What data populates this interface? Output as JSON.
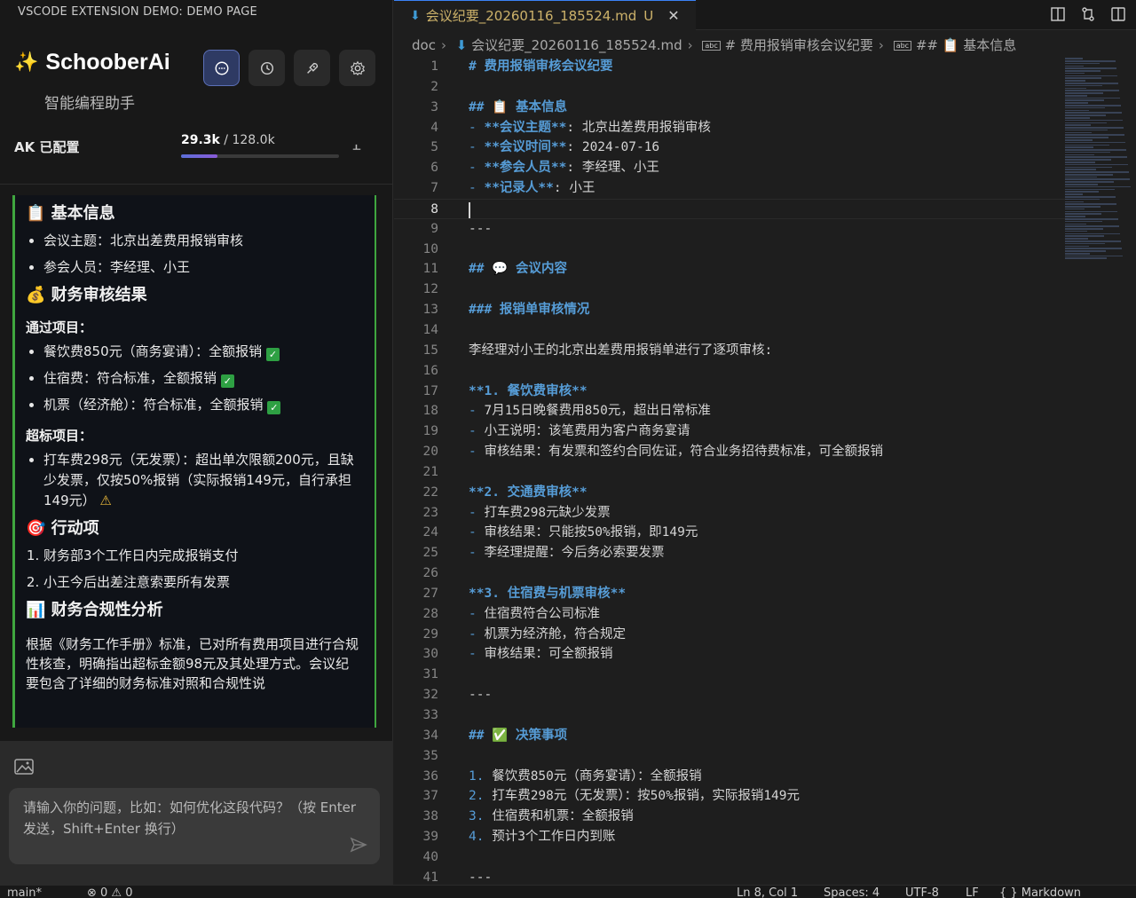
{
  "panel_title": "VSCODE EXTENSION DEMO: DEMO PAGE",
  "brand": {
    "icon": "sparkle-icon",
    "name": "SchooberAi",
    "subtitle": "智能编程助手"
  },
  "header_buttons": [
    "chat-icon",
    "history-icon",
    "rocket-icon",
    "gear-icon"
  ],
  "ak_status": "AK 已配置",
  "tokens": {
    "used": "29.3k",
    "separator": " / ",
    "total": "128.0k",
    "fraction": 0.229
  },
  "message": {
    "h_basic": "📋 基本信息",
    "basic_items": [
      "会议主题：北京出差费用报销审核",
      "参会人员：李经理、小王"
    ],
    "h_result": "💰 财务审核结果",
    "passed_label": "通过项目：",
    "passed_items": [
      "餐饮费850元（商务宴请）：全额报销",
      "住宿费：符合标准，全额报销",
      "机票（经济舱）：符合标准，全额报销"
    ],
    "over_label": "超标项目：",
    "over_items": [
      "打车费298元（无发票）：超出单次限额200元，且缺少发票，仅按50%报销（实际报销149元，自行承担149元）"
    ],
    "h_action": "🎯 行动项",
    "action_items": [
      "财务部3个工作日内完成报销支付",
      "小王今后出差注意索要所有发票"
    ],
    "h_compliance": "📊 财务合规性分析",
    "compliance_text": "根据《财务工作手册》标准，已对所有费用项目进行合规性核查，明确指出超标金额98元及其处理方式。会议纪要包含了详细的财务标准对照和合规性说"
  },
  "input": {
    "placeholder": "请输入你的问题，比如：如何优化这段代码？（按 Enter 发送，Shift+Enter 换行）"
  },
  "editor": {
    "tab": {
      "name": "会议纪要_20260116_185524.md",
      "modified": "U",
      "close": "✕"
    },
    "breadcrumbs": [
      "doc",
      "会议纪要_20260116_185524.md",
      "# 费用报销审核会议纪要",
      "## 📋 基本信息"
    ],
    "current_line": 8,
    "lines": [
      {
        "n": "1",
        "t": "# 费用报销审核会议纪要"
      },
      {
        "n": "2",
        "t": ""
      },
      {
        "n": "3",
        "t": "## 📋 基本信息"
      },
      {
        "n": "4",
        "t": "- **会议主题**: 北京出差费用报销审核"
      },
      {
        "n": "5",
        "t": "- **会议时间**: 2024-07-16"
      },
      {
        "n": "6",
        "t": "- **参会人员**: 李经理、小王"
      },
      {
        "n": "7",
        "t": "- **记录人**: 小王"
      },
      {
        "n": "8",
        "t": ""
      },
      {
        "n": "9",
        "t": "---"
      },
      {
        "n": "10",
        "t": ""
      },
      {
        "n": "11",
        "t": "## 💬 会议内容"
      },
      {
        "n": "12",
        "t": ""
      },
      {
        "n": "13",
        "t": "### 报销单审核情况"
      },
      {
        "n": "14",
        "t": ""
      },
      {
        "n": "15",
        "t": "李经理对小王的北京出差费用报销单进行了逐项审核:"
      },
      {
        "n": "16",
        "t": ""
      },
      {
        "n": "17",
        "t": "**1. 餐饮费审核**"
      },
      {
        "n": "18",
        "t": "- 7月15日晚餐费用850元，超出日常标准"
      },
      {
        "n": "19",
        "t": "- 小王说明：该笔费用为客户商务宴请"
      },
      {
        "n": "20",
        "t": "- 审核结果：有发票和签约合同佐证，符合业务招待费标准，可全额报销"
      },
      {
        "n": "21",
        "t": ""
      },
      {
        "n": "22",
        "t": "**2. 交通费审核**"
      },
      {
        "n": "23",
        "t": "- 打车费298元缺少发票"
      },
      {
        "n": "24",
        "t": "- 审核结果：只能按50%报销，即149元"
      },
      {
        "n": "25",
        "t": "- 李经理提醒：今后务必索要发票"
      },
      {
        "n": "26",
        "t": ""
      },
      {
        "n": "27",
        "t": "**3. 住宿费与机票审核**"
      },
      {
        "n": "28",
        "t": "- 住宿费符合公司标准"
      },
      {
        "n": "29",
        "t": "- 机票为经济舱，符合规定"
      },
      {
        "n": "30",
        "t": "- 审核结果：可全额报销"
      },
      {
        "n": "31",
        "t": ""
      },
      {
        "n": "32",
        "t": "---"
      },
      {
        "n": "33",
        "t": ""
      },
      {
        "n": "34",
        "t": "## ✅ 决策事项"
      },
      {
        "n": "35",
        "t": ""
      },
      {
        "n": "36",
        "t": "1. 餐饮费850元（商务宴请）：全额报销"
      },
      {
        "n": "37",
        "t": "2. 打车费298元（无发票）：按50%报销，实际报销149元"
      },
      {
        "n": "38",
        "t": "3. 住宿费和机票：全额报销"
      },
      {
        "n": "39",
        "t": "4. 预计3个工作日内到账"
      },
      {
        "n": "40",
        "t": ""
      },
      {
        "n": "41",
        "t": "---"
      }
    ]
  },
  "status": {
    "branch": "main*",
    "problems": "⊗ 0 ⚠ 0",
    "position": "Ln 8, Col 1",
    "spaces": "Spaces: 4",
    "encoding": "UTF-8",
    "eol": "LF",
    "language": "{ } Markdown"
  }
}
